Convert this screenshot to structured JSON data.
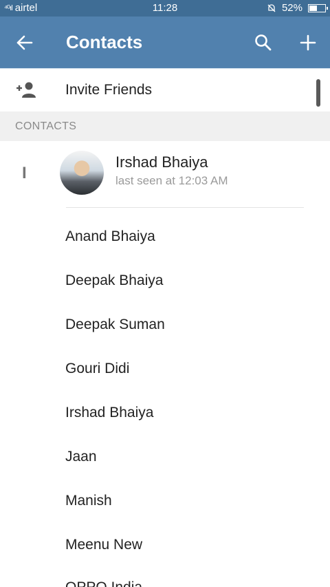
{
  "status_bar": {
    "carrier": "airtel",
    "signal_text": "⁴ᴳıl",
    "time": "11:28",
    "battery": "52%",
    "battery_level": 0.52
  },
  "app_bar": {
    "title": "Contacts",
    "back_icon": "arrow-left-icon",
    "search_icon": "search-icon",
    "add_icon": "plus-icon"
  },
  "invite": {
    "label": "Invite Friends",
    "icon": "add-person-icon"
  },
  "section_header": "CONTACTS",
  "featured_contact": {
    "index_letter": "I",
    "name": "Irshad Bhaiya",
    "last_seen": "last seen at 12:03 AM"
  },
  "contacts": [
    {
      "name": "Anand Bhaiya"
    },
    {
      "name": "Deepak Bhaiya"
    },
    {
      "name": "Deepak Suman"
    },
    {
      "name": "Gouri Didi"
    },
    {
      "name": "Irshad Bhaiya"
    },
    {
      "name": "Jaan"
    },
    {
      "name": "Manish"
    },
    {
      "name": "Meenu New"
    },
    {
      "name": "OPPO India"
    }
  ]
}
